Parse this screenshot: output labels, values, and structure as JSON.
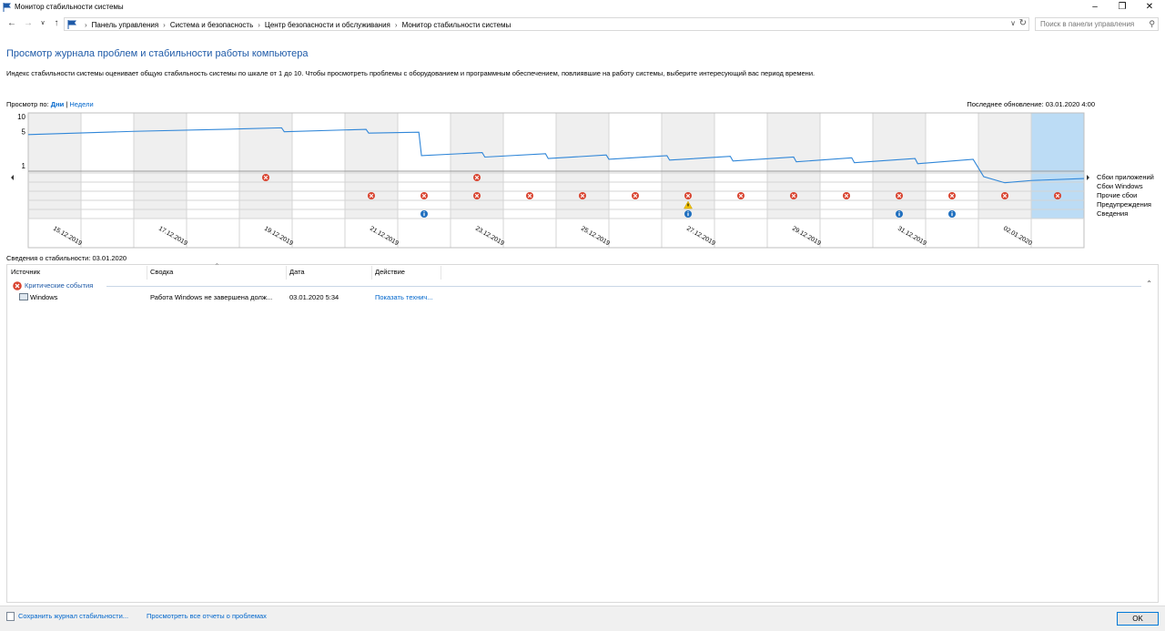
{
  "window": {
    "title": "Монитор стабильности системы",
    "minimize_icon": "minimize-icon",
    "maximize_icon": "restore-icon",
    "close_icon": "close-icon"
  },
  "addressbar": {
    "breadcrumbs": [
      "Панель управления",
      "Система и безопасность",
      "Центр безопасности и обслуживания",
      "Монитор стабильности системы"
    ],
    "search_placeholder": "Поиск в панели управления"
  },
  "header": {
    "title": "Просмотр журнала проблем и стабильности работы компьютера",
    "description": "Индекс стабильности системы оценивает общую стабильность системы по шкале от 1 до 10. Чтобы просмотреть проблемы с оборудованием и программным обеспечением, повлиявшие на работу системы, выберите интересующий вас период времени."
  },
  "view_by": {
    "label": "Просмотр по:",
    "days": "Дни",
    "separator": "|",
    "weeks": "Недели"
  },
  "last_updated": "Последнее обновление: 03.01.2020 4:00",
  "chart_data": {
    "type": "line",
    "yticks": [
      "10",
      "5",
      "1"
    ],
    "ylim": [
      1,
      10
    ],
    "x_labels": [
      "15.12.2019",
      "17.12.2019",
      "19.12.2019",
      "21.12.2019",
      "23.12.2019",
      "25.12.2019",
      "27.12.2019",
      "29.12.2019",
      "31.12.2019",
      "02.01.2020"
    ],
    "days": 20,
    "selected_day_index": 19,
    "series": [
      {
        "points": [
          [
            0,
            4.3
          ],
          [
            2,
            5.0
          ],
          [
            4,
            5.6
          ],
          [
            4.8,
            5.9
          ],
          [
            4.85,
            4.9
          ],
          [
            6.4,
            5.5
          ],
          [
            6.45,
            4.6
          ],
          [
            7.4,
            4.8
          ],
          [
            7.45,
            1.6
          ],
          [
            8.6,
            1.85
          ],
          [
            8.65,
            1.5
          ],
          [
            9.8,
            1.75
          ],
          [
            9.85,
            1.4
          ],
          [
            10.95,
            1.65
          ],
          [
            11,
            1.35
          ],
          [
            12.1,
            1.6
          ],
          [
            12.15,
            1.3
          ],
          [
            13.3,
            1.55
          ],
          [
            13.35,
            1.25
          ],
          [
            14.5,
            1.5
          ],
          [
            14.55,
            1.2
          ],
          [
            15.6,
            1.45
          ],
          [
            15.65,
            1.15
          ],
          [
            16.8,
            1.4
          ],
          [
            16.85,
            1.1
          ],
          [
            17.9,
            1.35
          ],
          [
            18.1,
            0.6
          ],
          [
            18.5,
            0.45
          ],
          [
            19,
            0.5
          ],
          [
            20,
            0.55
          ]
        ]
      }
    ],
    "event_rows": [
      "Сбои приложений",
      "Сбои Windows",
      "Прочие сбои",
      "Предупреждения",
      "Сведения"
    ],
    "events": [
      {
        "day": 4,
        "row": 0,
        "kind": "error"
      },
      {
        "day": 8,
        "row": 0,
        "kind": "error"
      },
      {
        "day": 6,
        "row": 2,
        "kind": "error"
      },
      {
        "day": 7,
        "row": 2,
        "kind": "error"
      },
      {
        "day": 8,
        "row": 2,
        "kind": "error"
      },
      {
        "day": 9,
        "row": 2,
        "kind": "error"
      },
      {
        "day": 10,
        "row": 2,
        "kind": "error"
      },
      {
        "day": 11,
        "row": 2,
        "kind": "error"
      },
      {
        "day": 12,
        "row": 2,
        "kind": "error"
      },
      {
        "day": 13,
        "row": 2,
        "kind": "error"
      },
      {
        "day": 14,
        "row": 2,
        "kind": "error"
      },
      {
        "day": 15,
        "row": 2,
        "kind": "error"
      },
      {
        "day": 16,
        "row": 2,
        "kind": "error"
      },
      {
        "day": 17,
        "row": 2,
        "kind": "error"
      },
      {
        "day": 18,
        "row": 2,
        "kind": "error"
      },
      {
        "day": 19,
        "row": 2,
        "kind": "error"
      },
      {
        "day": 12,
        "row": 3,
        "kind": "warning"
      },
      {
        "day": 7,
        "row": 4,
        "kind": "info"
      },
      {
        "day": 12,
        "row": 4,
        "kind": "info"
      },
      {
        "day": 16,
        "row": 4,
        "kind": "info"
      },
      {
        "day": 17,
        "row": 4,
        "kind": "info"
      }
    ]
  },
  "details": {
    "title": "Сведения о стабильности: 03.01.2020",
    "columns": [
      "Источник",
      "Сводка",
      "Дата",
      "Действие"
    ],
    "group_label": "Критические события",
    "rows": [
      {
        "source": "Windows",
        "summary": "Работа Windows не завершена долж...",
        "date": "03.01.2020 5:34",
        "action": "Показать технич..."
      }
    ]
  },
  "footer": {
    "save_link": "Сохранить журнал стабильности...",
    "reports_link": "Просмотреть все отчеты о проблемах",
    "ok": "OK"
  },
  "colors": {
    "accent": "#1e5aa8",
    "link": "#0066cc",
    "line": "#2f86d8",
    "error": "#d9432f",
    "warning": "#f2c200",
    "info": "#1f6fbf",
    "shade": "#efefef",
    "selected": "#bcdcf5"
  }
}
